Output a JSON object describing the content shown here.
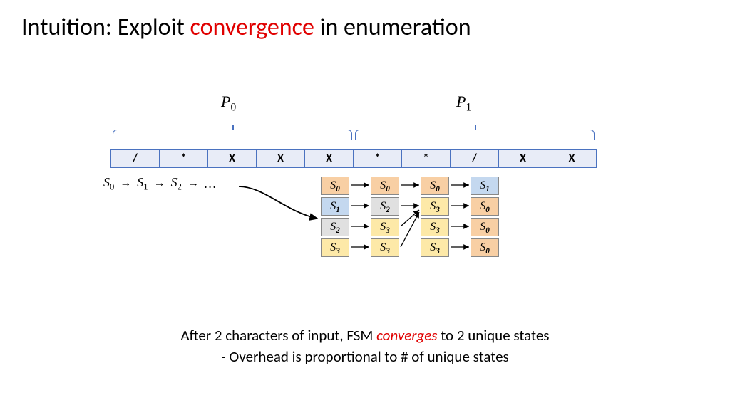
{
  "title": {
    "pre": "Intuition: Exploit ",
    "highlight": "convergence",
    "post": " in enumeration"
  },
  "partitions": {
    "p0": "P",
    "p0_sub": "0",
    "p1": "P",
    "p1_sub": "1"
  },
  "input_cells": [
    "/",
    "*",
    "X",
    "X",
    "X",
    "*",
    "*",
    "/",
    "X",
    "X"
  ],
  "left_chain": {
    "s0": "S",
    "s0s": "0",
    "s1": "S",
    "s1s": "1",
    "s2": "S",
    "s2s": "2",
    "dots": "…"
  },
  "grid": {
    "rows": [
      {
        "cells": [
          {
            "label": "S",
            "sub": "0",
            "color": "c-orange"
          },
          {
            "label": "S",
            "sub": "0",
            "color": "c-orange"
          },
          {
            "label": "S",
            "sub": "0",
            "color": "c-orange"
          },
          {
            "label": "S",
            "sub": "1",
            "color": "c-blue"
          }
        ]
      },
      {
        "cells": [
          {
            "label": "S",
            "sub": "1",
            "color": "c-blue"
          },
          {
            "label": "S",
            "sub": "2",
            "color": "c-gray"
          },
          {
            "label": "S",
            "sub": "3",
            "color": "c-yellow"
          },
          {
            "label": "S",
            "sub": "0",
            "color": "c-orange"
          }
        ]
      },
      {
        "cells": [
          {
            "label": "S",
            "sub": "2",
            "color": "c-gray"
          },
          {
            "label": "S",
            "sub": "3",
            "color": "c-yellow"
          },
          {
            "label": "S",
            "sub": "3",
            "color": "c-yellow"
          },
          {
            "label": "S",
            "sub": "0",
            "color": "c-orange"
          }
        ]
      },
      {
        "cells": [
          {
            "label": "S",
            "sub": "3",
            "color": "c-yellow"
          },
          {
            "label": "S",
            "sub": "3",
            "color": "c-yellow"
          },
          {
            "label": "S",
            "sub": "3",
            "color": "c-yellow"
          },
          {
            "label": "S",
            "sub": "0",
            "color": "c-orange"
          }
        ]
      }
    ]
  },
  "caption": {
    "line1_pre": "After 2 characters of input, FSM ",
    "line1_em": "converges",
    "line1_post": " to 2 unique states",
    "line2": "- Overhead is proportional to # of unique states"
  },
  "arrow_glyph": "→"
}
